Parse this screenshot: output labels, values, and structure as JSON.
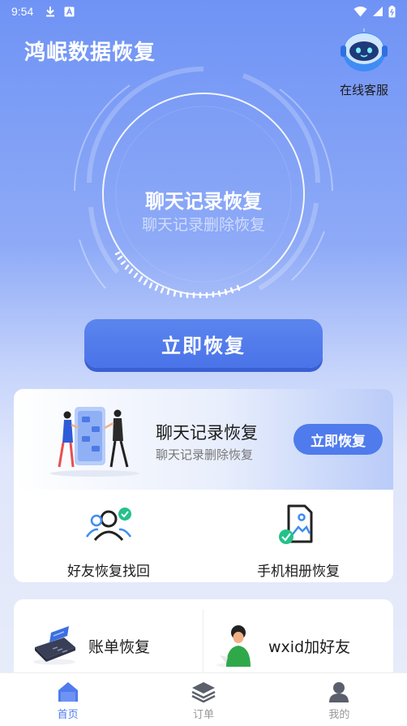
{
  "status": {
    "time": "9:54"
  },
  "header": {
    "title": "鸿岷数据恢复",
    "service_label": "在线客服"
  },
  "hero": {
    "title": "聊天记录恢复",
    "subtitle": "聊天记录删除恢复",
    "button_label": "立即恢复"
  },
  "card1": {
    "title": "聊天记录恢复",
    "subtitle": "聊天记录删除恢复",
    "button_label": "立即恢复",
    "features": [
      {
        "label": "好友恢复找回",
        "icon": "friends-icon"
      },
      {
        "label": "手机相册恢复",
        "icon": "photo-album-icon"
      }
    ]
  },
  "card2": {
    "items": [
      {
        "label": "账单恢复",
        "icon": "bill-icon"
      },
      {
        "label": "wxid加好友",
        "icon": "add-friend-person-icon"
      }
    ]
  },
  "tabbar": {
    "tabs": [
      {
        "label": "首页",
        "icon": "home-icon",
        "active": true
      },
      {
        "label": "订单",
        "icon": "orders-icon",
        "active": false
      },
      {
        "label": "我的",
        "icon": "profile-icon",
        "active": false
      }
    ]
  },
  "colors": {
    "accent": "#4f7bec",
    "header_gradient_top": "#6f93f5"
  }
}
